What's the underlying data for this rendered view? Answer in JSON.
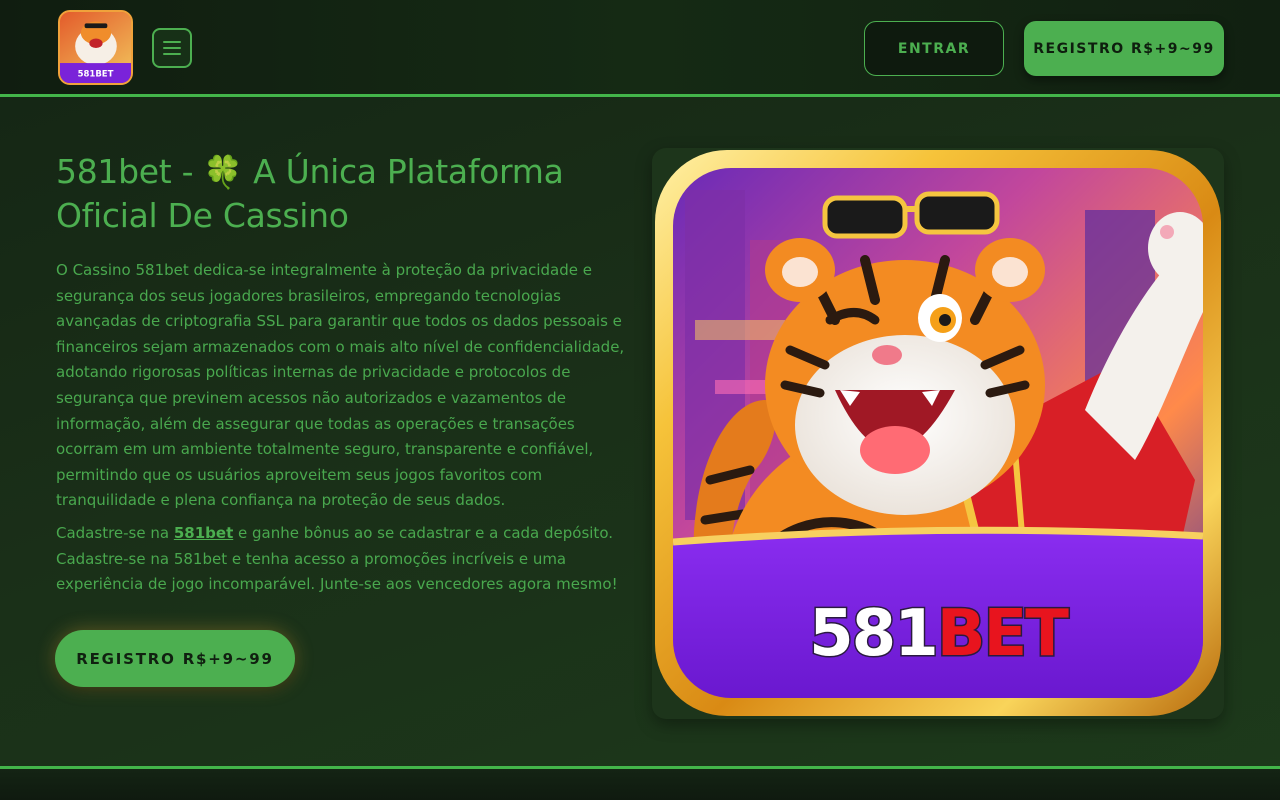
{
  "header": {
    "logo_alt": "581BET",
    "logo_text": "581BET",
    "login_label": "ENTRAR",
    "register_label": "REGISTRO R$+9~99"
  },
  "hero": {
    "title_prefix": "581bet -",
    "title_emoji": "🍀",
    "title_suffix": "A Única Plataforma Oficial De Cassino",
    "paragraph1": "O Cassino 581bet dedica-se integralmente à proteção da privacidade e segurança dos seus jogadores brasileiros, empregando tecnologias avançadas de criptografia SSL para garantir que todos os dados pessoais e financeiros sejam armazenados com o mais alto nível de confidencialidade, adotando rigorosas políticas internas de privacidade e protocolos de segurança que previnem acessos não autorizados e vazamentos de informação, além de assegurar que todas as operações e transações ocorram em um ambiente totalmente seguro, transparente e confiável, permitindo que os usuários aproveitem seus jogos favoritos com tranquilidade e plena confiança na proteção de seus dados.",
    "paragraph2_before": "Cadastre-se na ",
    "paragraph2_link": "581bet",
    "paragraph2_after": " e ganhe bônus ao se cadastrar e a cada depósito. Cadastre-se na 581bet e tenha acesso a promoções incríveis e uma experiência de jogo incomparável. Junte-se aos vencedores agora mesmo!",
    "cta_label": "REGISTRO R$+9~99"
  },
  "image": {
    "banner_text_white": "581",
    "banner_text_red": "BET"
  },
  "colors": {
    "accent": "#4caf50",
    "background": "#142514",
    "banner_purple": "#7b22e0",
    "frame_gold": "#f2b42e"
  }
}
